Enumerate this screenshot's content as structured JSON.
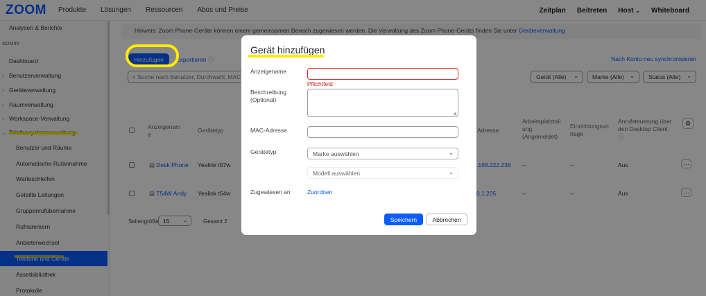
{
  "nav": {
    "logo": "zoom",
    "links": [
      "Produkte",
      "Lösungen",
      "Ressourcen",
      "Abos und Preise"
    ],
    "right": [
      "Zeitplan",
      "Beitreten",
      "Host",
      "Whiteboard"
    ]
  },
  "sidebar": {
    "top_item": "Analysen & Berichte",
    "admin_label": "ADMIN",
    "dashboard": "Dashboard",
    "groups": [
      "Benutzerverwaltung",
      "Geräteverwaltung",
      "Raumverwaltung",
      "Workspace-Verwaltung",
      "Telefonsystemverwaltung"
    ],
    "sub_items": [
      "Benutzer und Räume",
      "Automatische Rufannahme",
      "Warteschleifen",
      "Geteilte Leitungen",
      "Gruppenrufübernahme",
      "Rufnummern",
      "Anbieterwechsel",
      "Telefone und Geräte",
      "Assetbibliothek",
      "Protokolle"
    ]
  },
  "main": {
    "hint_text": "Hinweis: Zoom Phone-Geräte können einem gemeinsamen Bereich zugewiesen werden. Die Verwaltung des Zoom Phone-Geräts finden Sie unter ",
    "hint_link": "Geräteverwaltung",
    "add_button": "Hinzufügen",
    "export": "Exportieren",
    "sync": "Nach Konto neu synchronisieren",
    "search_placeholder": "Suche nach Benutzer, Durchwahl, MAC-",
    "filters": [
      "Gerät (Alle)",
      "Marke (Alle)",
      "Status (Alle)"
    ],
    "columns": {
      "name": "Anzeigenam e",
      "type": "Gerätetyp",
      "ip": "Adresse",
      "workplace": "Arbeitsplatzteil ung (Angemeldet)",
      "setup": "Einrichtungsvo rlage",
      "call_control": "Anrufsteuerung über den Desktop Client"
    },
    "rows": [
      {
        "name": "Desk Phone",
        "type": "Yealink t57w",
        "ip": ".168.222.239",
        "workplace": "--",
        "setup": "--",
        "call_control": "Aus"
      },
      {
        "name": "T54W Andy",
        "type": "Yealink t54w",
        "ip": "0.1.205",
        "workplace": "--",
        "setup": "--",
        "call_control": "Aus"
      }
    ],
    "page_size_label": "Seitengröße",
    "page_size": "15",
    "total": "Gesamt 2"
  },
  "modal": {
    "title": "Gerät hinzufügen",
    "name_label": "Anzeigename",
    "name_value": "",
    "required_error": "Pflichtfeld",
    "desc_label": "Beschreibung (Optional)",
    "mac_label": "MAC-Adresse",
    "type_label": "Gerätetyp",
    "brand_placeholder": "Marke auswählen",
    "model_placeholder": "Modell auswählen",
    "assigned_label": "Zugewiesen an",
    "assign_link": "Zuordnen",
    "save": "Speichern",
    "cancel": "Abbrechen"
  },
  "colors": {
    "accent": "#0b5cff",
    "error": "#e02828",
    "highlight": "#ffeb00"
  }
}
